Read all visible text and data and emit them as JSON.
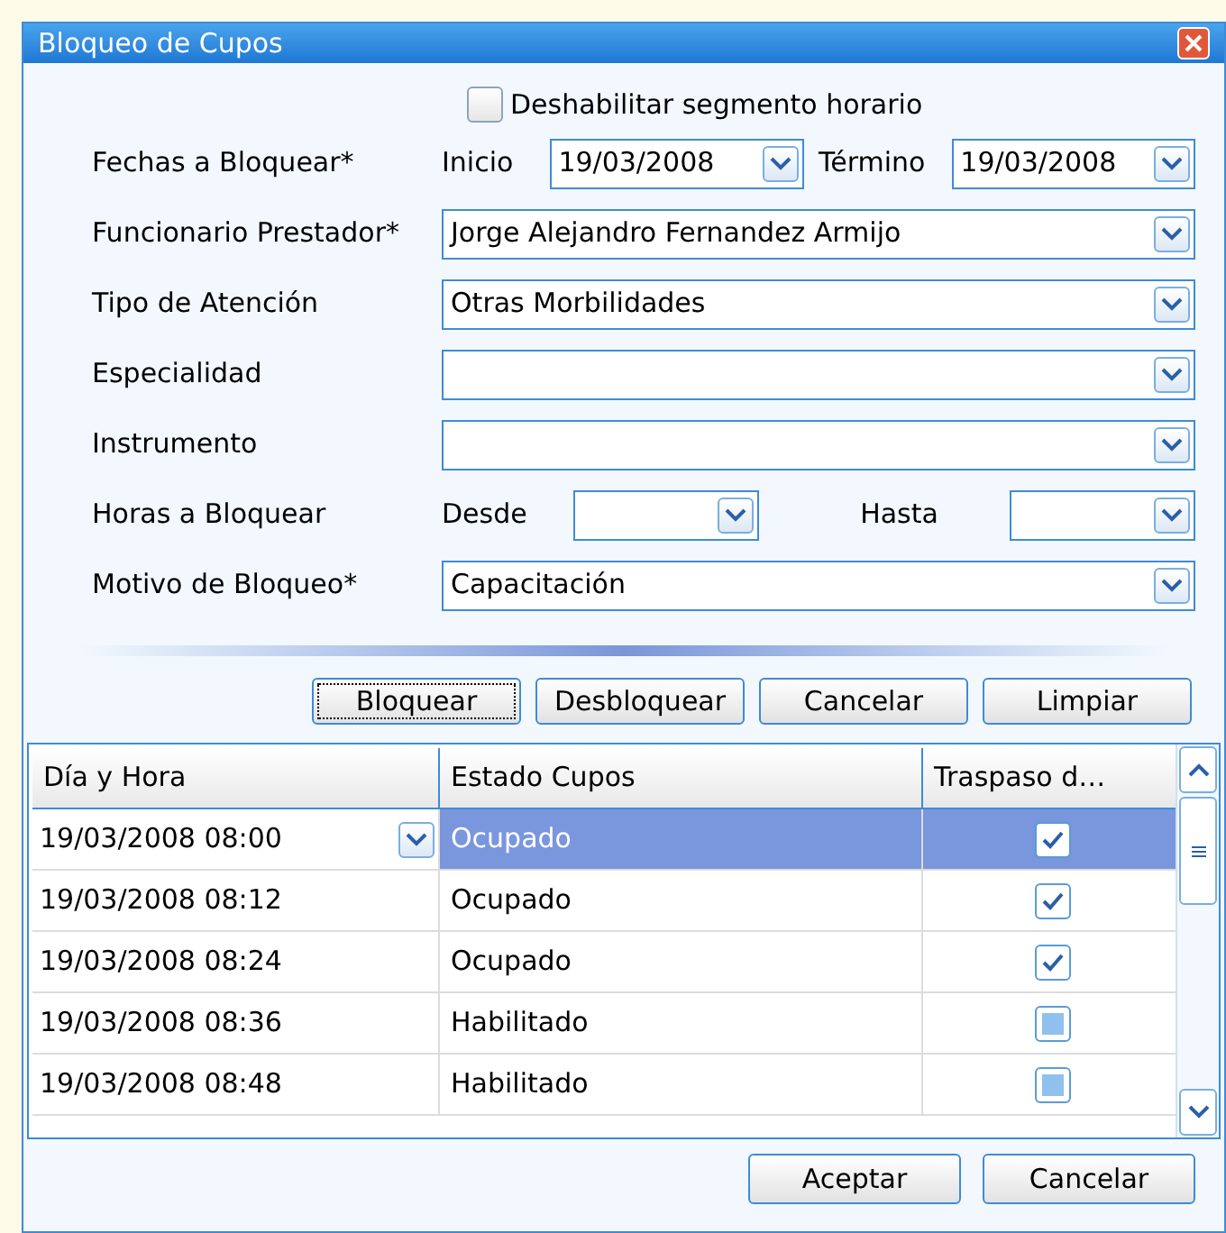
{
  "window": {
    "title": "Bloqueo de Cupos"
  },
  "disable_segment": {
    "label": "Deshabilitar segmento horario",
    "checked": false
  },
  "fields": [
    {
      "kind": "date_range",
      "label": "Fechas a Bloquear*",
      "start_label": "Inicio",
      "start_value": "19/03/2008",
      "end_label": "Término",
      "end_value": "19/03/2008"
    },
    {
      "kind": "combo",
      "label": "Funcionario Prestador*",
      "value": "Jorge Alejandro Fernandez Armijo"
    },
    {
      "kind": "combo",
      "label": "Tipo de Atención",
      "value": "Otras Morbilidades"
    },
    {
      "kind": "combo",
      "label": "Especialidad"
    },
    {
      "kind": "combo",
      "label": "Instrumento"
    },
    {
      "kind": "time_range",
      "label": "Horas a Bloquear",
      "start_label": "Desde",
      "end_label": "Hasta"
    },
    {
      "kind": "combo",
      "label": "Motivo de Bloqueo*",
      "value": "Capacitación"
    }
  ],
  "actions": [
    {
      "label": "Bloquear",
      "focused": true
    },
    {
      "label": "Desbloquear",
      "focused": false
    },
    {
      "label": "Cancelar",
      "focused": false
    },
    {
      "label": "Limpiar",
      "focused": false
    }
  ],
  "table": {
    "columns": [
      "Día y Hora",
      "Estado Cupos",
      "Traspaso d…"
    ],
    "rows": [
      {
        "datetime": "19/03/2008 08:00",
        "status": "Ocupado",
        "checked": true,
        "selected": true
      },
      {
        "datetime": "19/03/2008 08:12",
        "status": "Ocupado",
        "checked": true,
        "selected": false
      },
      {
        "datetime": "19/03/2008 08:24",
        "status": "Ocupado",
        "checked": true,
        "selected": false
      },
      {
        "datetime": "19/03/2008 08:36",
        "status": "Habilitado",
        "checked": false,
        "selected": false
      },
      {
        "datetime": "19/03/2008 08:48",
        "status": "Habilitado",
        "checked": false,
        "selected": false
      }
    ]
  },
  "buttons": [
    "Aceptar",
    "Cancelar"
  ]
}
